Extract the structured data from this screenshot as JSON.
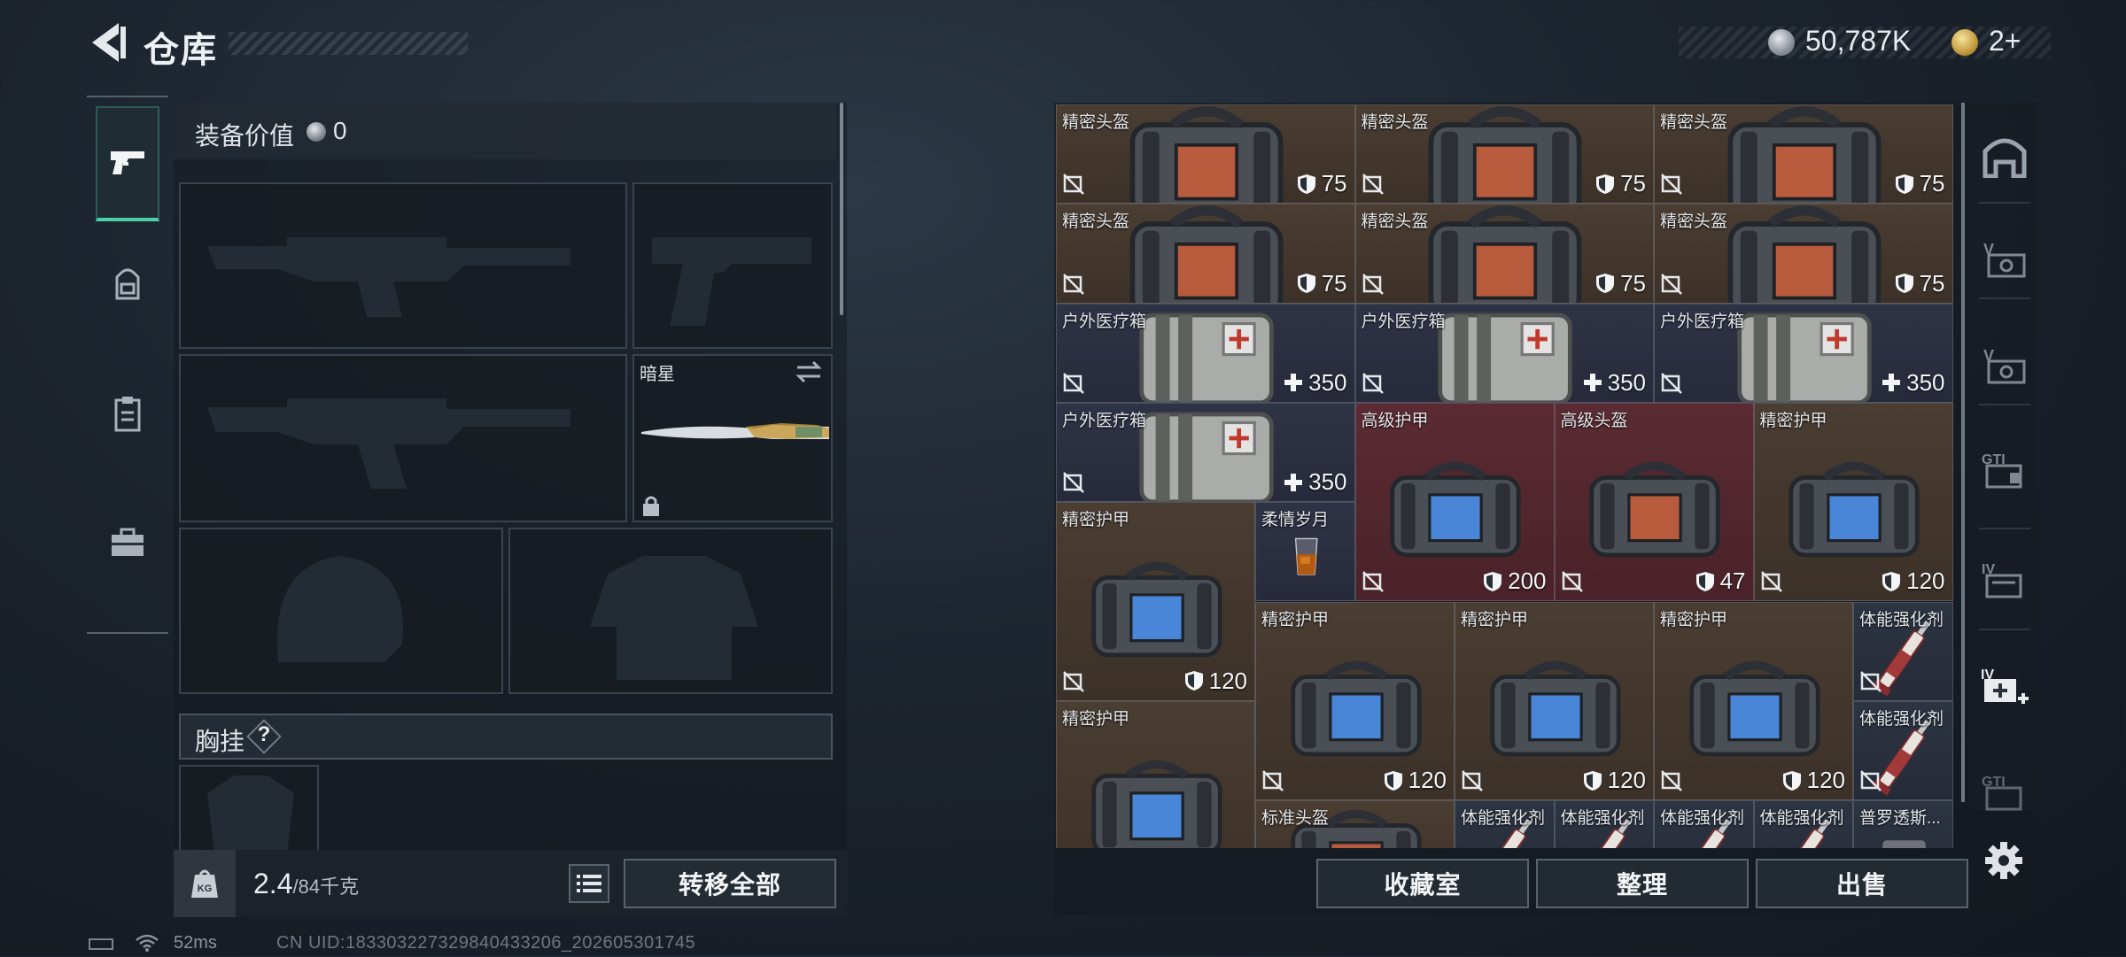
{
  "header": {
    "title": "仓库",
    "back_icon": "back-arrow-icon"
  },
  "currency": {
    "coins": "50,787K",
    "tickets": "2+"
  },
  "tabs": [
    {
      "name": "weapon",
      "icon": "pistol-icon",
      "active": true
    },
    {
      "name": "backpack",
      "icon": "backpack-icon",
      "active": false
    },
    {
      "name": "vest",
      "icon": "clipboard-icon",
      "active": false
    },
    {
      "name": "toolbox",
      "icon": "briefcase-icon",
      "active": false
    }
  ],
  "loadout": {
    "equip_value_label": "装备价值",
    "equip_value": "0",
    "melee_name": "暗星",
    "chest_rig_label": "胸挂",
    "chest_rig_help": "?",
    "weight_value": "2.4",
    "weight_max": "/84千克",
    "transfer_all": "转移全部"
  },
  "storage": {
    "cells": [
      {
        "name": "精密头盔",
        "value": "75",
        "value_icon": "shield-icon",
        "kind": "helmet-bag",
        "color": "brown"
      },
      {
        "name": "精密头盔",
        "value": "75",
        "value_icon": "shield-icon",
        "kind": "helmet-bag",
        "color": "brown"
      },
      {
        "name": "精密头盔",
        "value": "75",
        "value_icon": "shield-icon",
        "kind": "helmet-bag",
        "color": "brown"
      },
      {
        "name": "精密头盔",
        "value": "75",
        "value_icon": "shield-icon",
        "kind": "helmet-bag",
        "color": "brown"
      },
      {
        "name": "精密头盔",
        "value": "75",
        "value_icon": "shield-icon",
        "kind": "helmet-bag",
        "color": "brown"
      },
      {
        "name": "精密头盔",
        "value": "75",
        "value_icon": "shield-icon",
        "kind": "helmet-bag",
        "color": "brown"
      },
      {
        "name": "户外医疗箱",
        "value": "350",
        "value_icon": "plus-icon",
        "kind": "medkit",
        "color": "blue"
      },
      {
        "name": "户外医疗箱",
        "value": "350",
        "value_icon": "plus-icon",
        "kind": "medkit",
        "color": "blue"
      },
      {
        "name": "户外医疗箱",
        "value": "350",
        "value_icon": "plus-icon",
        "kind": "medkit",
        "color": "blue"
      },
      {
        "name": "户外医疗箱",
        "value": "350",
        "value_icon": "plus-icon",
        "kind": "medkit",
        "color": "blue"
      },
      {
        "name": "高级护甲",
        "value": "200",
        "value_icon": "shield-icon",
        "kind": "armor-bag-big",
        "color": "red"
      },
      {
        "name": "高级头盔",
        "value": "47",
        "value_icon": "shield-icon",
        "kind": "helmet-bag-big",
        "color": "red"
      },
      {
        "name": "精密护甲",
        "value": "120",
        "value_icon": "shield-icon",
        "kind": "armor-bag",
        "color": "brown"
      },
      {
        "name": "精密护甲",
        "value": "120",
        "value_icon": "shield-icon",
        "kind": "armor-bag",
        "color": "brown"
      },
      {
        "name": "柔情岁月",
        "value": "",
        "value_icon": "",
        "kind": "drink",
        "color": "blue"
      },
      {
        "name": "精密护甲",
        "value": "120",
        "value_icon": "shield-icon",
        "kind": "armor-bag",
        "color": "brown"
      },
      {
        "name": "精密护甲",
        "value": "120",
        "value_icon": "shield-icon",
        "kind": "armor-bag",
        "color": "brown"
      },
      {
        "name": "精密护甲",
        "value": "120",
        "value_icon": "shield-icon",
        "kind": "armor-bag",
        "color": "brown"
      },
      {
        "name": "体能强化剂",
        "value": "",
        "value_icon": "",
        "kind": "syringe",
        "color": "dark"
      },
      {
        "name": "体能强化剂",
        "value": "",
        "value_icon": "",
        "kind": "syringe",
        "color": "dark"
      },
      {
        "name": "精密护甲",
        "value": "",
        "value_icon": "",
        "kind": "armor-bag",
        "color": "brown"
      },
      {
        "name": "标准头盔",
        "value": "",
        "value_icon": "",
        "kind": "helmet-bag",
        "color": "brown"
      },
      {
        "name": "体能强化剂",
        "value": "",
        "value_icon": "",
        "kind": "syringe",
        "color": "dark"
      },
      {
        "name": "体能强化剂",
        "value": "",
        "value_icon": "",
        "kind": "syringe",
        "color": "dark"
      },
      {
        "name": "体能强化剂",
        "value": "",
        "value_icon": "",
        "kind": "syringe",
        "color": "dark"
      },
      {
        "name": "体能强化剂",
        "value": "",
        "value_icon": "",
        "kind": "syringe",
        "color": "dark"
      },
      {
        "name": "普罗透斯...",
        "value": "",
        "value_icon": "",
        "kind": "item",
        "color": "dark"
      }
    ]
  },
  "actions": {
    "collection_room": "收藏室",
    "organize": "整理",
    "sell": "出售"
  },
  "rail": [
    {
      "icon": "safehouse-icon"
    },
    {
      "icon": "v-case-icon"
    },
    {
      "icon": "v-case-2-icon"
    },
    {
      "icon": "gti-case-icon"
    },
    {
      "icon": "iv-case-icon"
    },
    {
      "icon": "iv-add-case-icon"
    },
    {
      "icon": "gti-case-2-icon"
    }
  ],
  "status": {
    "ping": "52ms",
    "uid": "CN UID:183303227329840433206_202605301745"
  },
  "colors": {
    "accent": "#4dd0a8",
    "brown_cell": "#4a3d32",
    "blue_cell": "#2f3346",
    "red_cell": "#5b2b33"
  }
}
